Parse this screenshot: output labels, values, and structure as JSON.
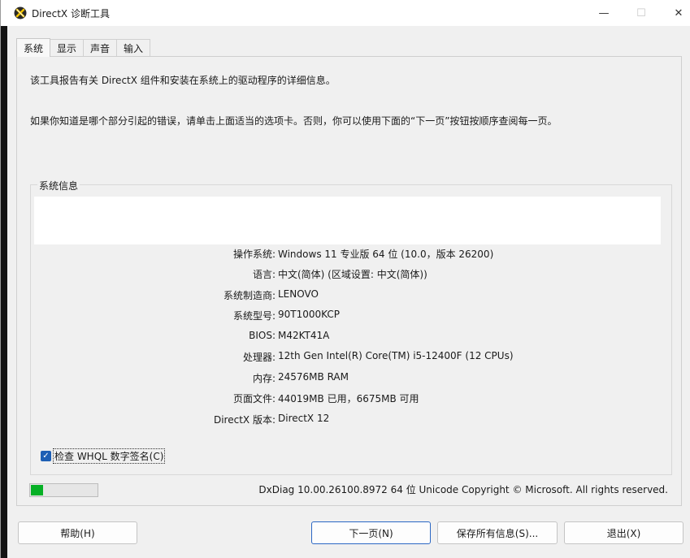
{
  "window": {
    "title": "DirectX 诊断工具",
    "minimize_glyph": "—",
    "maximize_glyph": "☐",
    "close_glyph": "✕"
  },
  "tabs": [
    {
      "label": "系统",
      "active": true
    },
    {
      "label": "显示",
      "active": false
    },
    {
      "label": "声音",
      "active": false
    },
    {
      "label": "输入",
      "active": false
    }
  ],
  "intro": {
    "line1": "该工具报告有关 DirectX 组件和安装在系统上的驱动程序的详细信息。",
    "line2": "如果你知道是哪个部分引起的错误，请单击上面适当的选项卡。否则，你可以使用下面的“下一页”按钮按顺序查阅每一页。"
  },
  "system_info": {
    "title": "系统信息",
    "rows": [
      {
        "label": "操作系统:",
        "value": "Windows 11 专业版 64 位 (10.0，版本 26200)"
      },
      {
        "label": "语言:",
        "value": "中文(简体) (区域设置: 中文(简体))"
      },
      {
        "label": "系统制造商:",
        "value": "LENOVO"
      },
      {
        "label": "系统型号:",
        "value": "90T1000KCP"
      },
      {
        "label": "BIOS:",
        "value": "M42KT41A"
      },
      {
        "label": "处理器:",
        "value": "12th Gen Intel(R) Core(TM) i5-12400F (12 CPUs)"
      },
      {
        "label": "内存:",
        "value": "24576MB RAM"
      },
      {
        "label": "页面文件:",
        "value": "44019MB 已用，6675MB 可用"
      },
      {
        "label": "DirectX 版本:",
        "value": "DirectX 12"
      }
    ]
  },
  "whql": {
    "label": "检查 WHQL 数字签名(C)",
    "checked": true,
    "check_glyph": "✓"
  },
  "progress": {
    "fraction": 0.18
  },
  "footer": {
    "copyright": "DxDiag 10.00.26100.8972 64 位 Unicode  Copyright © Microsoft. All rights reserved."
  },
  "buttons": {
    "help": "帮助(H)",
    "next": "下一页(N)",
    "save": "保存所有信息(S)...",
    "exit": "退出(X)"
  },
  "colors": {
    "accent": "#1e5fb4",
    "progress": "#06b025",
    "default_button_border": "#2b67c4"
  }
}
